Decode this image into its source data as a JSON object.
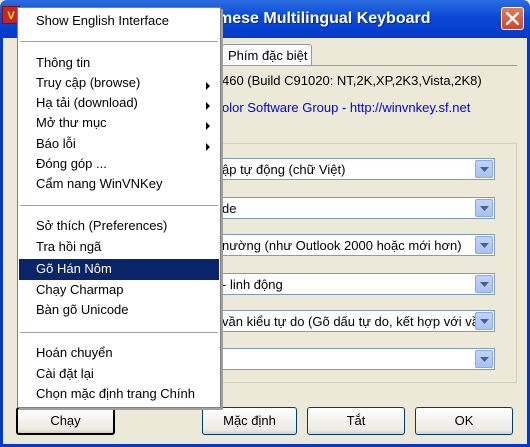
{
  "window": {
    "title": "mese Multilingual Keyboard",
    "app_icon_letter": "V"
  },
  "tabs": {
    "special_label": "Phím đặc biệt"
  },
  "info": {
    "version_line": "460 (Build C91020: NT,2K,XP,2K3,Vista,2K8)",
    "link_text": "olor Software Group - http://winvnkey.sf.net"
  },
  "combos": [
    {
      "text": "ập tự động (chữ Việt)"
    },
    {
      "text": "de"
    },
    {
      "text": "nường (như Outlook 2000 hoặc mới hơn)"
    },
    {
      "text": "- linh động"
    },
    {
      "text": "vần kiểu tự do (Gõ dấu tự do, kết hợp với vần"
    },
    {
      "text": ""
    }
  ],
  "buttons": {
    "run": "Chạy",
    "default": "Mặc định",
    "off": "Tắt",
    "ok": "OK"
  },
  "menu": {
    "show_english": "Show English Interface",
    "info": "Thông tin",
    "browse": "Truy cập (browse)",
    "download": "Hạ tải (download)",
    "open_folder": "Mở thư mục",
    "report_bug": "Báo lỗi",
    "contribute": "Đóng góp ...",
    "handbook": "Cẩm nang WinVNKey",
    "preferences": "Sở thích (Preferences)",
    "dictionary": "Tra hồi ngã",
    "han_nom": "Gõ Hán Nôm",
    "charmap": "Chạy Charmap",
    "unicode": "Bàn gõ Unicode",
    "convert": "Hoán chuyển",
    "reinstall": "Cài đặt lại",
    "main_default": "Chọn mặc định trang Chính"
  }
}
